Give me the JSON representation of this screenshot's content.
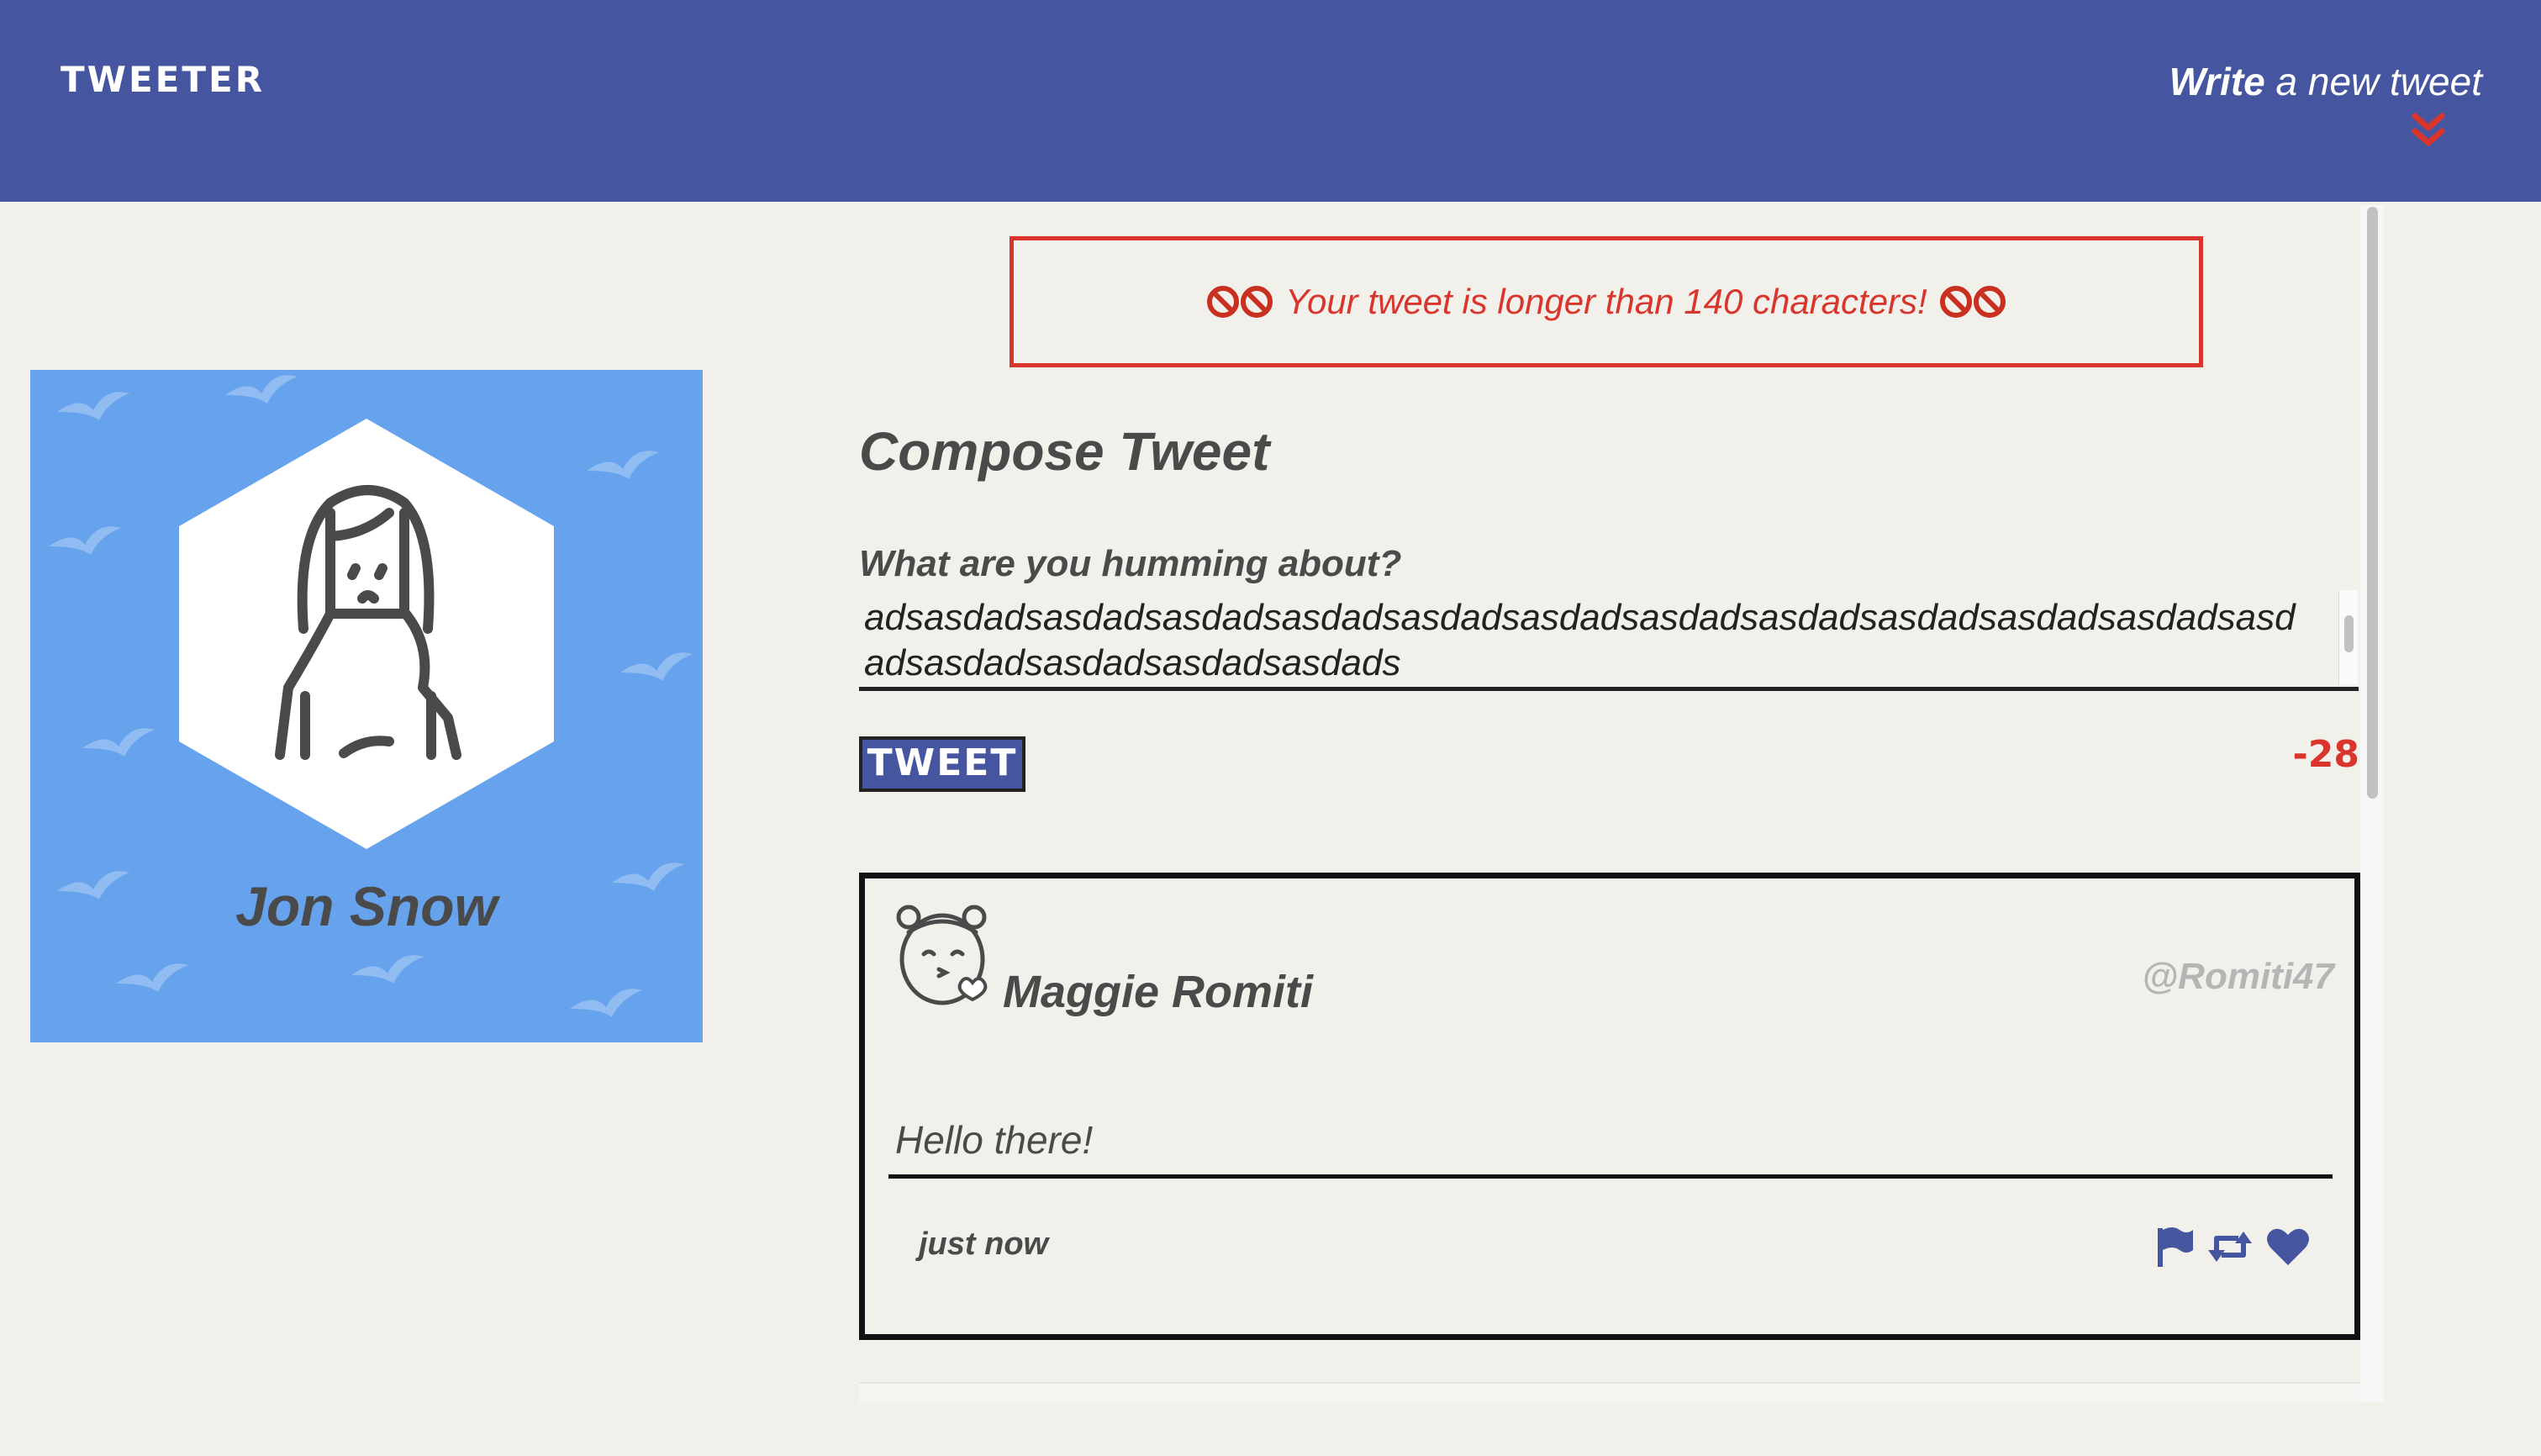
{
  "nav": {
    "brand": "TWEETER",
    "write_bold": "Write",
    "write_rest": " a new tweet"
  },
  "profile": {
    "name": "Jon Snow"
  },
  "compose": {
    "error": "Your tweet is longer than 140 characters!",
    "title": "Compose Tweet",
    "question": "What are you humming about?",
    "text": "adsasdadsasdadsasdadsasdadsasdadsasdadsasdadsasdadsasdadsasdadsasdadsasdadsasdadsasdadsasdadsasdads",
    "button": "TWEET",
    "counter": "-28"
  },
  "tweets": [
    {
      "name": "Maggie Romiti",
      "handle": "@Romiti47",
      "text": "Hello there!",
      "time": "just now"
    }
  ],
  "icons": {
    "nav_arrow": "double-chevron-down-icon",
    "error": "no-entry-icon",
    "actions": [
      "flag-icon",
      "retweet-icon",
      "heart-icon"
    ]
  },
  "colors": {
    "nav": "#4655a0",
    "error": "#d9352c",
    "profile_bg": "#66a3ec",
    "page_bg": "#f2f0eb"
  }
}
